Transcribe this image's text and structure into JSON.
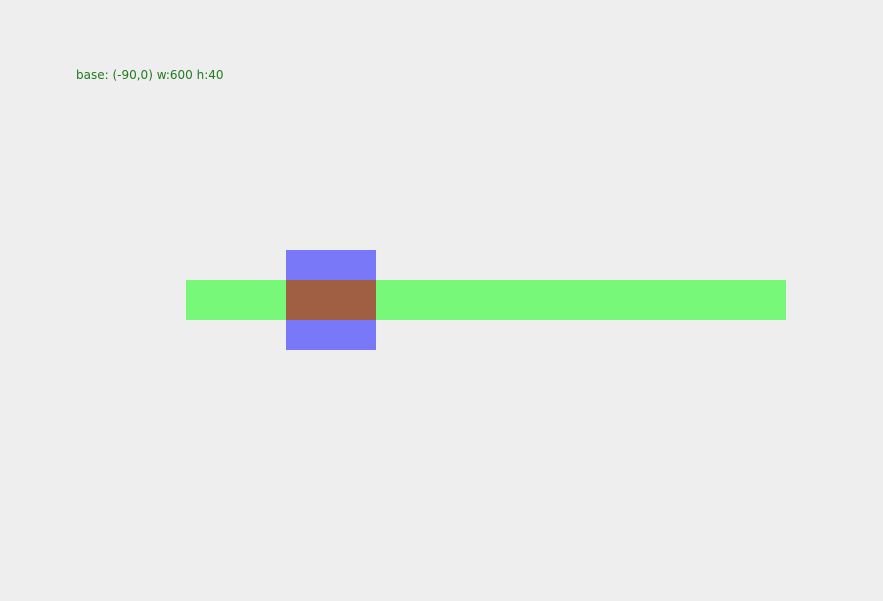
{
  "labels": {
    "base_info": "base: (-90,0) w:600 h:40"
  },
  "colors": {
    "background": "#eeeeee",
    "label_text": "#1f7a1f",
    "base_fill": "#78f878",
    "overlay_fill": "#7878f8",
    "intersection_fill": "#a05e42"
  }
}
